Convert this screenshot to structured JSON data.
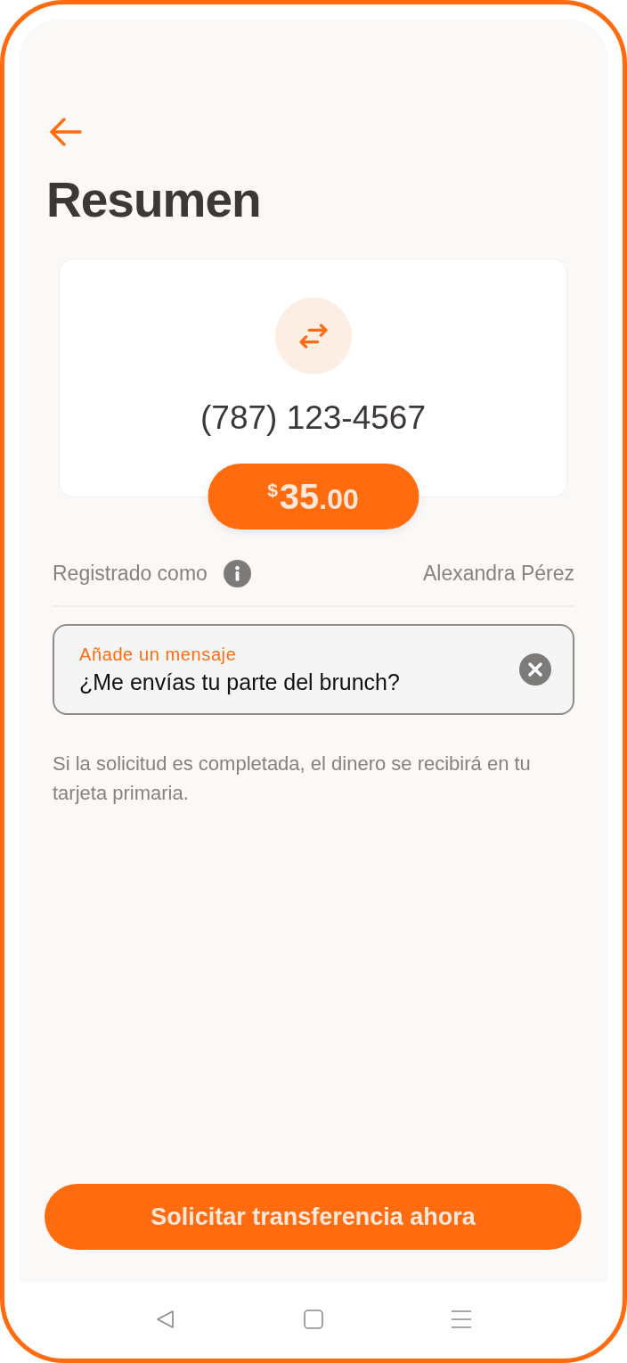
{
  "header": {
    "title": "Resumen"
  },
  "recipient": {
    "phone": "(787) 123-4567"
  },
  "amount": {
    "currency": "$",
    "whole": "35",
    "cents": ".00"
  },
  "registered": {
    "label": "Registrado como",
    "name": "Alexandra Pérez"
  },
  "message_field": {
    "label": "Añade un mensaje",
    "value": "¿Me envías tu parte del brunch?"
  },
  "note": "Si la solicitud es completada, el dinero se recibirá en tu tarjeta primaria.",
  "primary_button": "Solicitar transferencia ahora"
}
